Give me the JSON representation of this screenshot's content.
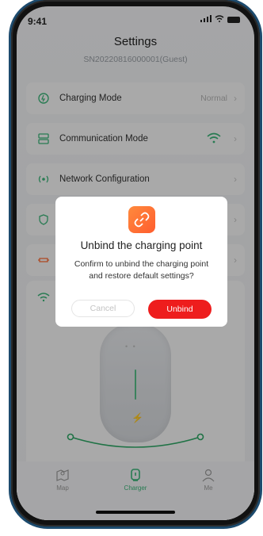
{
  "status_bar": {
    "time": "9:41"
  },
  "header": {
    "title": "Settings",
    "subtitle": "SN20220816000001(Guest)"
  },
  "settings_rows": [
    {
      "label": "Charging Mode",
      "value": "Normal",
      "icon": "charging-mode-icon"
    },
    {
      "label": "Communication Mode",
      "value": "",
      "icon": "communication-mode-icon"
    },
    {
      "label": "Network Configuration",
      "value": "",
      "icon": "network-icon"
    },
    {
      "label": "",
      "value": "",
      "icon": "shield-icon"
    },
    {
      "label": "",
      "value": "",
      "icon": "plug-icon"
    }
  ],
  "dialog": {
    "title": "Unbind the charging point",
    "message": "Confirm to unbind the charging point and restore default settings?",
    "cancel_label": "Cancel",
    "confirm_label": "Unbind",
    "icon": "unlink-icon"
  },
  "tabbar": {
    "items": [
      {
        "label": "Map",
        "icon": "map-icon"
      },
      {
        "label": "Charger",
        "icon": "charger-icon"
      },
      {
        "label": "Me",
        "icon": "person-icon"
      }
    ],
    "active": "Charger"
  },
  "colors": {
    "accent": "#3bb57a",
    "danger": "#ee1d1d",
    "brand_orange": "#ff6a33"
  }
}
